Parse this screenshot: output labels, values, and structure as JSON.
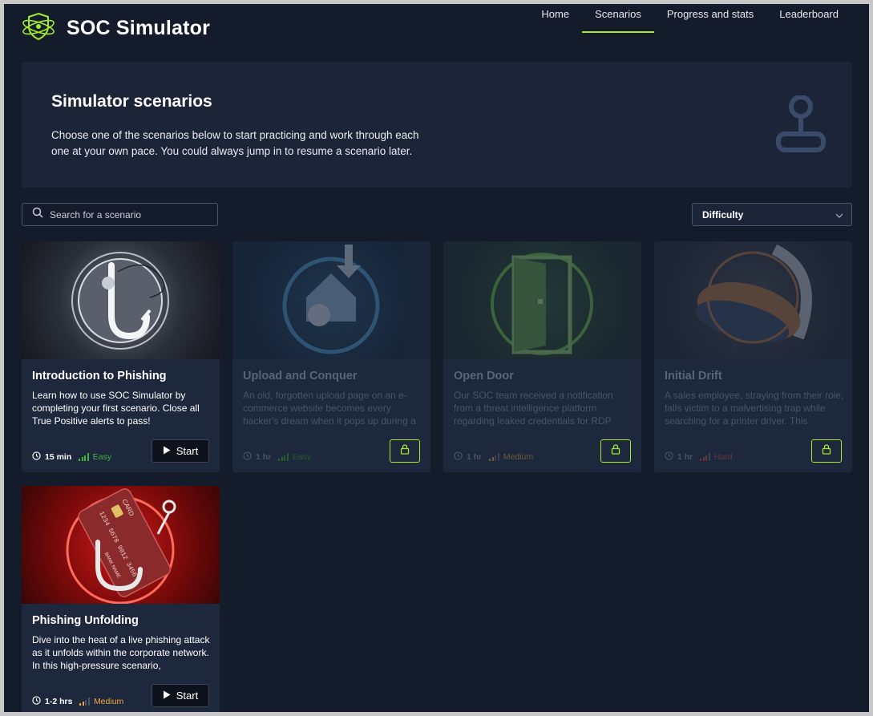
{
  "app": {
    "title": "SOC Simulator"
  },
  "nav": {
    "items": [
      "Home",
      "Scenarios",
      "Progress and stats",
      "Leaderboard"
    ],
    "active": "Scenarios"
  },
  "hero": {
    "title": "Simulator scenarios",
    "description": "Choose one of the scenarios below to start practicing and work through each one at your own pace. You could always jump in to resume a scenario later."
  },
  "search": {
    "placeholder": "Search for a scenario",
    "value": ""
  },
  "filter": {
    "label": "Difficulty"
  },
  "colors": {
    "accent": "#a3ea2a",
    "easy": "#3cb33c",
    "medium": "#f0a53c",
    "hard": "#d14a5a",
    "background": "#141c2c",
    "card": "#1e283c"
  },
  "scenarios": [
    {
      "title": "Introduction to Phishing",
      "description": "Learn how to use SOC Simulator by completing your first scenario. Close all True Positive alerts to pass!",
      "duration": "15 min",
      "difficulty": "Easy",
      "action": "Start",
      "locked": false,
      "image_icon": "fishing-hook-icon"
    },
    {
      "title": "Upload and Conquer",
      "description": "An old, forgotten upload page on an e-commerce website becomes every hacker's dream when it pops up during a",
      "duration": "1 hr",
      "difficulty": "Easy",
      "locked": true,
      "image_icon": "cloud-upload-icon"
    },
    {
      "title": "Open Door",
      "description": "Our SOC team received a notification from a threat intelligence platform regarding leaked credentials for RDP",
      "duration": "1 hr",
      "difficulty": "Medium",
      "locked": true,
      "image_icon": "open-door-icon"
    },
    {
      "title": "Initial Drift",
      "description": "A sales employee, straying from their role, falls victim to a malvertising trap while searching for a printer driver. This",
      "duration": "1 hr",
      "difficulty": "Hard",
      "locked": true,
      "image_icon": "mouse-icon"
    },
    {
      "title": "Phishing Unfolding",
      "description": "Dive into the heat of a live phishing attack as it unfolds within the corporate network. In this high-pressure scenario,",
      "duration": "1-2 hrs",
      "difficulty": "Medium",
      "action": "Start",
      "locked": false,
      "image_icon": "credit-card-hook-icon",
      "card_text": {
        "brand": "CARD",
        "number": "1234 5678 9012 3456",
        "holder": "BANK NAME"
      }
    }
  ]
}
